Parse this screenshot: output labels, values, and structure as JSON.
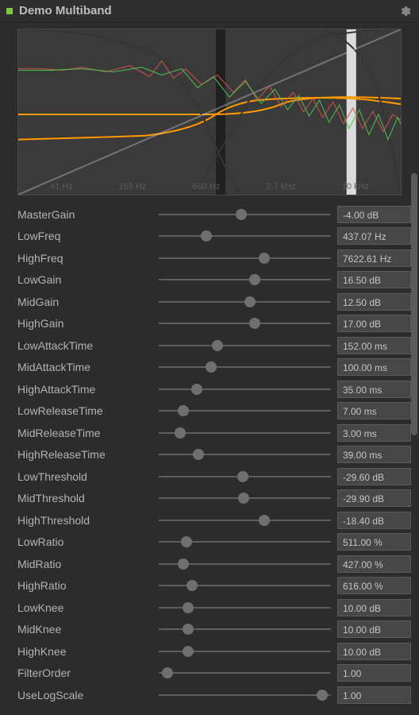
{
  "header": {
    "title": "Demo Multiband"
  },
  "graph": {
    "xlabels": [
      "41 Hz",
      "165 Hz",
      "660 Hz",
      "2.7 kHz",
      "10 kHz"
    ]
  },
  "params": [
    {
      "name": "MasterGain",
      "value": "-4.00 dB",
      "pos": 0.48
    },
    {
      "name": "LowFreq",
      "value": "437.07 Hz",
      "pos": 0.26
    },
    {
      "name": "HighFreq",
      "value": "7622.61 Hz",
      "pos": 0.62
    },
    {
      "name": "LowGain",
      "value": "16.50 dB",
      "pos": 0.56
    },
    {
      "name": "MidGain",
      "value": "12.50 dB",
      "pos": 0.53
    },
    {
      "name": "HighGain",
      "value": "17.00 dB",
      "pos": 0.56
    },
    {
      "name": "LowAttackTime",
      "value": "152.00 ms",
      "pos": 0.33
    },
    {
      "name": "MidAttackTime",
      "value": "100.00 ms",
      "pos": 0.29
    },
    {
      "name": "HighAttackTime",
      "value": "35.00 ms",
      "pos": 0.2
    },
    {
      "name": "LowReleaseTime",
      "value": "7.00 ms",
      "pos": 0.12
    },
    {
      "name": "MidReleaseTime",
      "value": "3.00 ms",
      "pos": 0.1
    },
    {
      "name": "HighReleaseTime",
      "value": "39.00 ms",
      "pos": 0.21
    },
    {
      "name": "LowThreshold",
      "value": "-29.60 dB",
      "pos": 0.49
    },
    {
      "name": "MidThreshold",
      "value": "-29.90 dB",
      "pos": 0.495
    },
    {
      "name": "HighThreshold",
      "value": "-18.40 dB",
      "pos": 0.62
    },
    {
      "name": "LowRatio",
      "value": "511.00 %",
      "pos": 0.14
    },
    {
      "name": "MidRatio",
      "value": "427.00 %",
      "pos": 0.12
    },
    {
      "name": "HighRatio",
      "value": "616.00 %",
      "pos": 0.17
    },
    {
      "name": "LowKnee",
      "value": "10.00 dB",
      "pos": 0.15
    },
    {
      "name": "MidKnee",
      "value": "10.00 dB",
      "pos": 0.15
    },
    {
      "name": "HighKnee",
      "value": "10.00 dB",
      "pos": 0.15
    },
    {
      "name": "FilterOrder",
      "value": "1.00",
      "pos": 0.02
    },
    {
      "name": "UseLogScale",
      "value": "1.00",
      "pos": 0.98
    }
  ]
}
